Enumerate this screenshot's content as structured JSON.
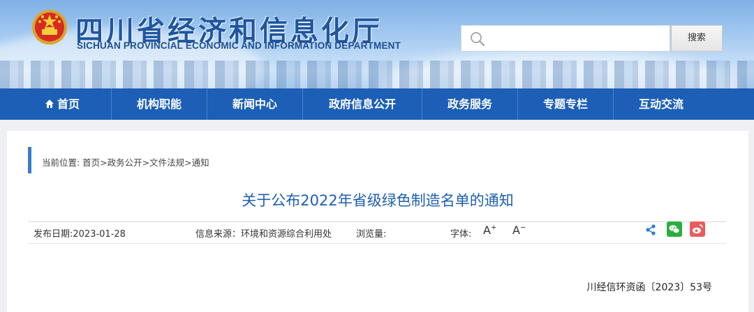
{
  "header": {
    "title_cn": "四川省经济和信息化厅",
    "title_en": "SICHUAN PROVINCIAL ECONOMIC AND INFORMATION DEPARTMENT"
  },
  "search": {
    "placeholder": "",
    "button_label": "搜索"
  },
  "nav": {
    "items": [
      {
        "label": "首页"
      },
      {
        "label": "机构职能"
      },
      {
        "label": "新闻中心"
      },
      {
        "label": "政府信息公开"
      },
      {
        "label": "政务服务"
      },
      {
        "label": "专题专栏"
      },
      {
        "label": "互动交流"
      }
    ]
  },
  "breadcrumb": {
    "text": "当前位置: 首页>政务公开>文件法规>通知"
  },
  "article": {
    "title": "关于公布2022年省级绿色制造名单的通知",
    "publish_date": "发布日期:2023-01-28",
    "source": "信息来源：环境和资源综合利用处",
    "views": "浏览量:",
    "font_label": "字体:",
    "font_increase": "A",
    "font_increase_mark": "+",
    "font_decrease": "A",
    "font_decrease_mark": "−",
    "doc_number": "川经信环资函〔2023〕53号"
  },
  "colors": {
    "nav_bg": "#1d5fb6",
    "title_blue": "#1e5fb0",
    "wechat": "#2aae3f",
    "weibo": "#e95c5c"
  }
}
